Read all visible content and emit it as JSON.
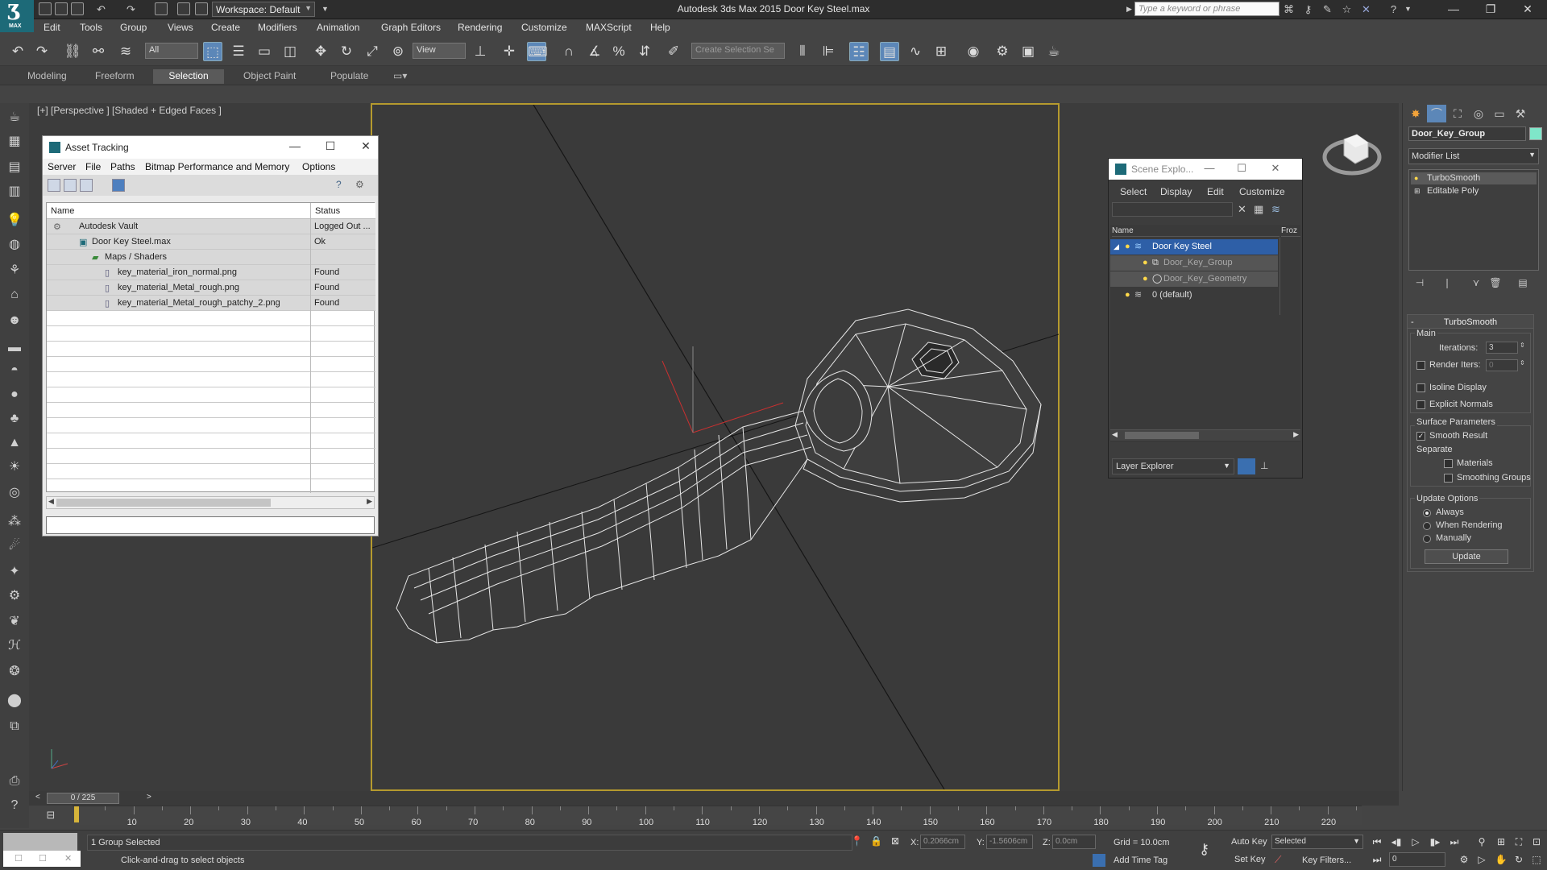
{
  "app": {
    "title": "Autodesk 3ds Max  2015    Door Key Steel.max",
    "logo_sub": "MAX",
    "workspace": "Workspace: Default",
    "search_placeholder": "Type a keyword or phrase"
  },
  "menubar": [
    "Edit",
    "Tools",
    "Group",
    "Views",
    "Create",
    "Modifiers",
    "Animation",
    "Graph Editors",
    "Rendering",
    "Customize",
    "MAXScript",
    "Help"
  ],
  "toolbar": {
    "selection_filter": "All",
    "ref_coord": "View",
    "named_selection": "Create Selection Se"
  },
  "ribbon_tabs": [
    {
      "label": "Modeling",
      "active": false
    },
    {
      "label": "Freeform",
      "active": false
    },
    {
      "label": "Selection",
      "active": true
    },
    {
      "label": "Object Paint",
      "active": false
    },
    {
      "label": "Populate",
      "active": false
    }
  ],
  "viewport": {
    "label": "[+] [Perspective ] [Shaded + Edged Faces ]",
    "border_color": "#b59a2e"
  },
  "asset_tracking": {
    "title": "Asset Tracking",
    "menus": [
      "Server",
      "File",
      "Paths",
      "Bitmap Performance and Memory",
      "Options"
    ],
    "columns": [
      "Name",
      "Status"
    ],
    "rows": [
      {
        "name": "Autodesk Vault",
        "status": "Logged Out ...",
        "indent": 0
      },
      {
        "name": "Door Key Steel.max",
        "status": "Ok",
        "indent": 1
      },
      {
        "name": "Maps / Shaders",
        "status": "",
        "indent": 2
      },
      {
        "name": "key_material_iron_normal.png",
        "status": "Found",
        "indent": 3
      },
      {
        "name": "key_material_Metal_rough.png",
        "status": "Found",
        "indent": 3
      },
      {
        "name": "key_material_Metal_rough_patchy_2.png",
        "status": "Found",
        "indent": 3
      }
    ]
  },
  "scene_explorer": {
    "title": "Scene Explo...",
    "menus": [
      "Select",
      "Display",
      "Edit",
      "Customize"
    ],
    "columns": [
      "Name",
      "Froz"
    ],
    "rows": [
      {
        "name": "Door Key Steel",
        "level": 0,
        "selected": true
      },
      {
        "name": "Door_Key_Group",
        "level": 1,
        "selected": false,
        "dim": true
      },
      {
        "name": "Door_Key_Geometry",
        "level": 1,
        "selected": false,
        "dim": true
      },
      {
        "name": "0 (default)",
        "level": 0,
        "selected": false
      }
    ],
    "layer_explorer": "Layer Explorer"
  },
  "command_panel": {
    "object_name": "Door_Key_Group",
    "object_color": "#7fe6c9",
    "modifier_list": "Modifier List",
    "stack": [
      {
        "label": "TurboSmooth",
        "active": true
      },
      {
        "label": "Editable Poly",
        "active": false
      }
    ],
    "turbosmooth": {
      "header": "TurboSmooth",
      "main_label": "Main",
      "iterations_label": "Iterations:",
      "iterations_value": "3",
      "render_iters_label": "Render Iters:",
      "render_iters_value": "0",
      "render_iters_checked": false,
      "isoline_label": "Isoline Display",
      "explicit_label": "Explicit Normals",
      "surface_label": "Surface Parameters",
      "smooth_result_label": "Smooth Result",
      "smooth_result_checked": true,
      "separate_label": "Separate",
      "materials_label": "Materials",
      "smoothing_label": "Smoothing Groups",
      "update_label": "Update Options",
      "update_options": [
        "Always",
        "When Rendering",
        "Manually"
      ],
      "update_selected": "Always",
      "update_button": "Update"
    }
  },
  "timeline": {
    "frame_display": "0 / 225",
    "ticks": [
      10,
      20,
      30,
      40,
      50,
      60,
      70,
      80,
      90,
      100,
      110,
      120,
      130,
      140,
      150,
      160,
      170,
      180,
      190,
      200,
      210,
      220
    ],
    "max_frame": 225
  },
  "status": {
    "selection": "1 Group Selected",
    "prompt": "Click-and-drag to select objects",
    "x_label": "X:",
    "x_value": "0.2066cm",
    "y_label": "Y:",
    "y_value": "-1.5606cm",
    "z_label": "Z:",
    "z_value": "0.0cm",
    "grid": "Grid = 10.0cm",
    "auto_key": "Auto Key",
    "set_key": "Set Key",
    "key_mode": "Selected",
    "key_filters": "Key Filters...",
    "add_time_tag": "Add Time Tag",
    "current_frame": "0"
  }
}
